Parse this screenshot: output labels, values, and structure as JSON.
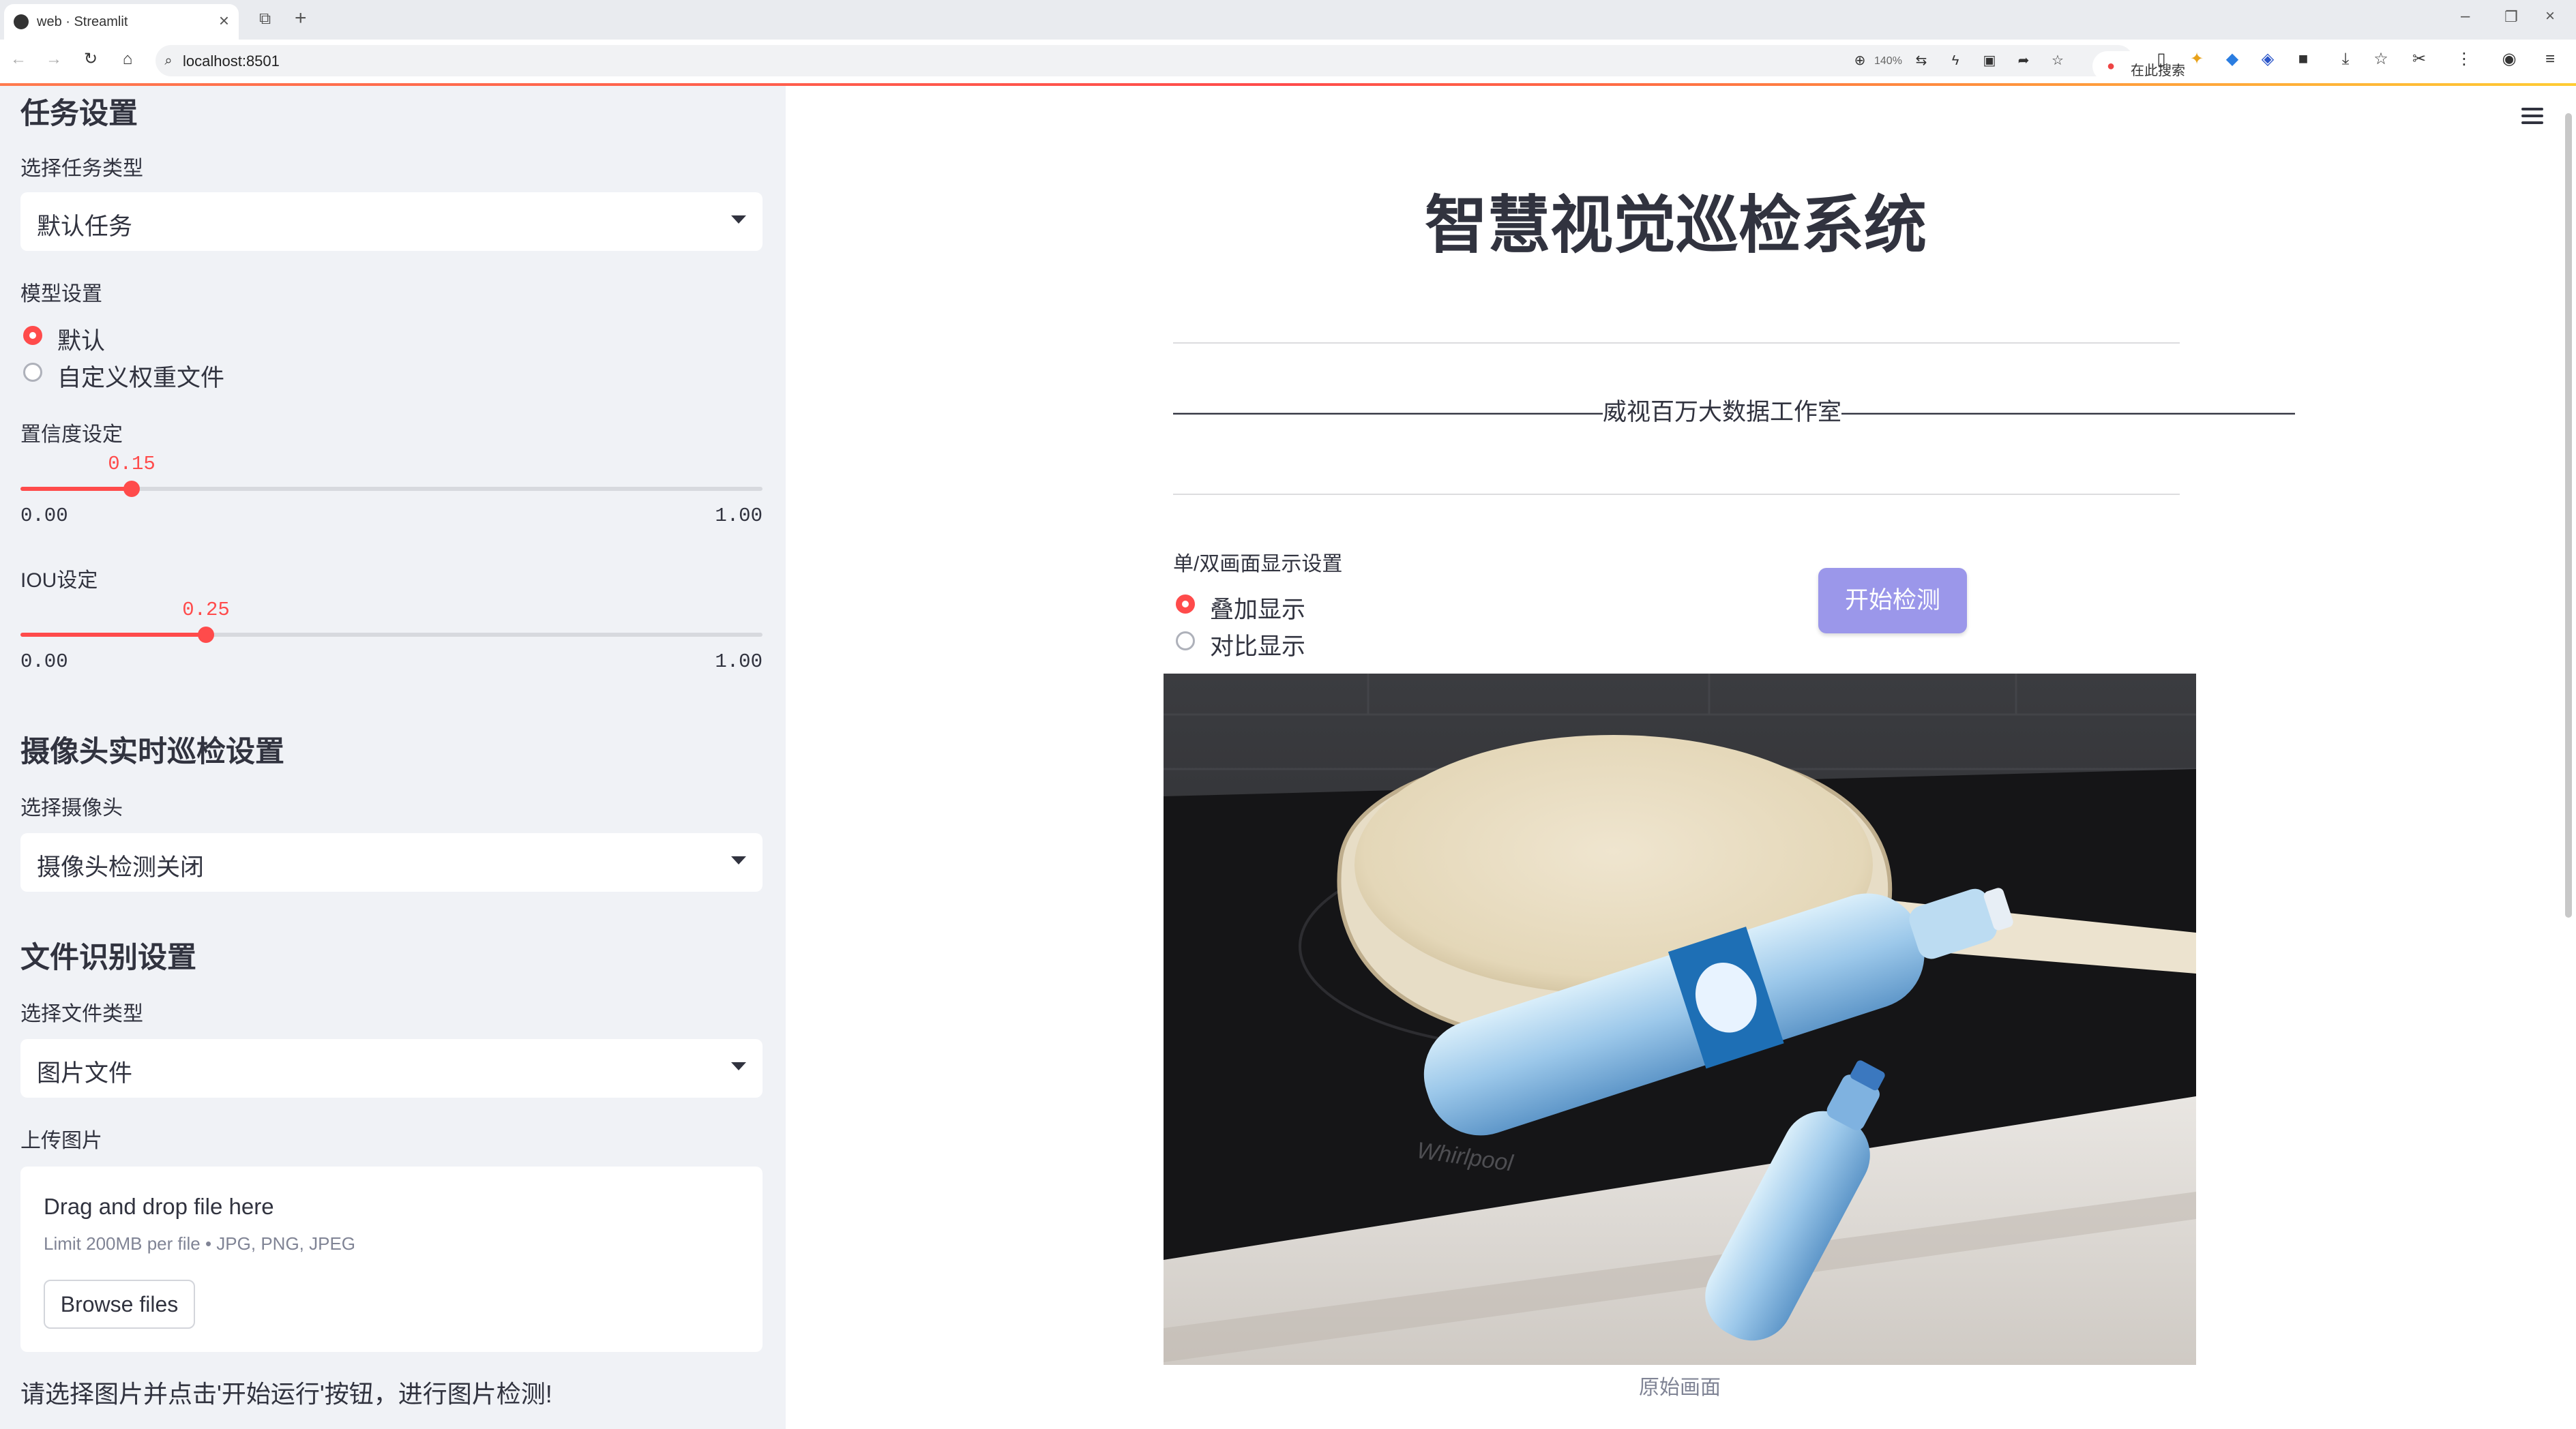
{
  "browser": {
    "tab_title": "web · Streamlit",
    "url": "localhost:8501",
    "zoom": "140%",
    "search_text": "在此搜索"
  },
  "sidebar": {
    "task_heading": "任务设置",
    "task_type_label": "选择任务类型",
    "task_type_value": "默认任务",
    "model_label": "模型设置",
    "model_options": [
      "默认",
      "自定义权重文件"
    ],
    "model_selected": "默认",
    "conf_label": "置信度设定",
    "conf": {
      "value": 0.15,
      "value_text": "0.15",
      "min": "0.00",
      "max": "1.00"
    },
    "iou_label": "IOU设定",
    "iou": {
      "value": 0.25,
      "value_text": "0.25",
      "min": "0.00",
      "max": "1.00"
    },
    "camera_heading": "摄像头实时巡检设置",
    "camera_label": "选择摄像头",
    "camera_value": "摄像头检测关闭",
    "file_heading": "文件识别设置",
    "file_type_label": "选择文件类型",
    "file_type_value": "图片文件",
    "upload_label": "上传图片",
    "uploader": {
      "main": "Drag and drop file here",
      "limit": "Limit 200MB per file • JPG, PNG, JPEG",
      "browse": "Browse files"
    },
    "hint": "请选择图片并点击'开始运行'按钮，进行图片检测!"
  },
  "main": {
    "title": "智慧视觉巡检系统",
    "subtitle": "——————————————————威视百万大数据工作室———————————————————",
    "display_label": "单/双画面显示设置",
    "display_options": [
      "叠加显示",
      "对比显示"
    ],
    "display_selected": "叠加显示",
    "start_button": "开始检测",
    "image_caption": "原始画面",
    "image_brand_text": "Whirlpool"
  },
  "colors": {
    "accent": "#ff4b4b",
    "button": "#9b97ea",
    "sidebar_bg": "#f0f2f6"
  }
}
